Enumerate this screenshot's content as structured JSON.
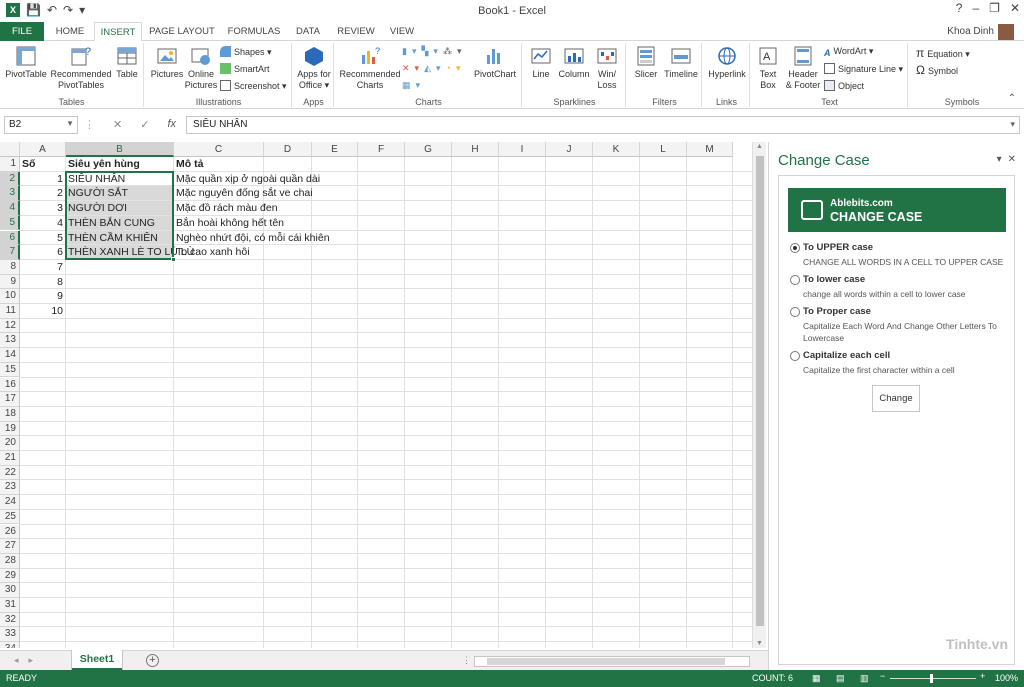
{
  "app": {
    "window_title": "Book1 - Excel",
    "user": "Khoa Dinh",
    "window_controls": {
      "help": "?",
      "minimize": "–",
      "restore": "❐",
      "close": "✕"
    }
  },
  "ribbon_tabs": [
    {
      "label": "FILE"
    },
    {
      "label": "HOME"
    },
    {
      "label": "INSERT"
    },
    {
      "label": "PAGE LAYOUT"
    },
    {
      "label": "FORMULAS"
    },
    {
      "label": "DATA"
    },
    {
      "label": "REVIEW"
    },
    {
      "label": "VIEW"
    }
  ],
  "ribbon": {
    "groups": {
      "tables": "Tables",
      "illustrations": "Illustrations",
      "apps": "Apps",
      "charts": "Charts",
      "sparklines": "Sparklines",
      "filters": "Filters",
      "links": "Links",
      "text": "Text",
      "symbols": "Symbols"
    },
    "buttons": {
      "pivottable": "PivotTable",
      "recommended_pivot_1": "Recommended",
      "recommended_pivot_2": "PivotTables",
      "table": "Table",
      "pictures": "Pictures",
      "online_1": "Online",
      "online_2": "Pictures",
      "shapes": "Shapes ▾",
      "smartart": "SmartArt",
      "screenshot": "Screenshot ▾",
      "apps_1": "Apps for",
      "apps_2": "Office ▾",
      "rec_charts_1": "Recommended",
      "rec_charts_2": "Charts",
      "pivotchart": "PivotChart",
      "line": "Line",
      "column": "Column",
      "winloss_1": "Win/",
      "winloss_2": "Loss",
      "slicer": "Slicer",
      "timeline": "Timeline",
      "hyperlink": "Hyperlink",
      "textbox_1": "Text",
      "textbox_2": "Box",
      "header_1": "Header",
      "header_2": "& Footer",
      "wordart": "WordArt ▾",
      "signature": "Signature Line ▾",
      "object": "Object",
      "equation": "Equation ▾",
      "symbol": "Symbol"
    }
  },
  "formula_bar": {
    "name_box": "B2",
    "fx": "fx",
    "cancel": "✕",
    "enter": "✓",
    "content": "SIÊU NHÂN"
  },
  "sheet": {
    "columns": [
      "A",
      "B",
      "C",
      "D",
      "E",
      "F",
      "G",
      "H",
      "I",
      "J",
      "K",
      "L",
      "M"
    ],
    "rows": [
      "1",
      "2",
      "3",
      "4",
      "5",
      "6",
      "7",
      "8",
      "9",
      "10",
      "11",
      "12",
      "13",
      "14",
      "15",
      "16",
      "17",
      "18",
      "19",
      "20",
      "21",
      "22",
      "23",
      "24",
      "25",
      "26",
      "27",
      "28",
      "29",
      "30",
      "31",
      "32",
      "33",
      "34"
    ],
    "header_row": {
      "a": "Số",
      "b": "Siêu yên hùng",
      "c": "Mô tả"
    },
    "data_rows": [
      {
        "a": "1",
        "b": "SIÊU NHÂN",
        "c": "Mặc quần xịp ở ngoài quần dài"
      },
      {
        "a": "2",
        "b": "NGƯỜI SẮT",
        "c": "Mặc nguyên đống sắt ve chai"
      },
      {
        "a": "3",
        "b": "NGƯỜI DƠI",
        "c": "Mặc đồ rách màu đen"
      },
      {
        "a": "4",
        "b": "THÈN BẮN CUNG",
        "c": "Bắn hoài không hết tên"
      },
      {
        "a": "5",
        "b": "THÈN CẦM KHIÊN",
        "c": "Nghèo nhứt đội, có mỗi cái khiên"
      },
      {
        "a": "6",
        "b": "THÈN XANH LÈ TO LÙ LÙ",
        "c": "To cao xanh hôi"
      }
    ],
    "extra_numbers": [
      "7",
      "8",
      "9",
      "10"
    ],
    "tab": "Sheet1",
    "add_sheet": "+"
  },
  "status": {
    "ready": "READY",
    "count": "COUNT: 6",
    "zoom": "100%"
  },
  "pane": {
    "title": "Change Case",
    "banner_small": "Ablebits.com",
    "banner_big": "CHANGE CASE",
    "options": [
      {
        "title": "To UPPER case",
        "desc": "CHANGE ALL WORDS IN A CELL TO UPPER CASE",
        "selected": true
      },
      {
        "title": "To lower case",
        "desc": "change all words within a cell to lower case",
        "selected": false
      },
      {
        "title": "To Proper case",
        "desc": "Capitalize Each Word And Change Other Letters To Lowercase",
        "selected": false
      },
      {
        "title": "Capitalize each cell",
        "desc": "Capitalize the first character within a cell",
        "selected": false
      }
    ],
    "button": "Change"
  },
  "watermark": "Tinhte.vn",
  "colors": {
    "accent": "#217346"
  }
}
